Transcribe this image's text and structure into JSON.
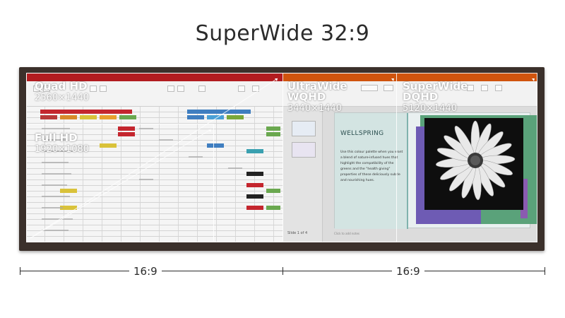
{
  "title": "SuperWide 32:9",
  "overlays": [
    {
      "id": "quad-hd",
      "name": "Quad HD",
      "resolution": "2560×1440"
    },
    {
      "id": "full-hd",
      "name": "Full HD",
      "resolution": "1920×1080"
    },
    {
      "id": "ultrawide",
      "name": "UltraWide",
      "subname": "WQHD",
      "resolution": "3440×1440"
    },
    {
      "id": "superwide",
      "name": "SuperWide",
      "subname": "DQHD",
      "resolution": "5120×1440"
    }
  ],
  "slide": {
    "heading": "WELLSPRING",
    "body": "Use this colour palette when you want a blend of nature-infused hues that highlight the compatibility of the greens and the \"health giving\" properties of these deliciously subtle and nourishing hues.",
    "slide_count": "Slide 1 of 4",
    "notes_placeholder": "Click to add notes"
  },
  "ruler": {
    "left_label": "16:9",
    "right_label": "16:9"
  },
  "colors": {
    "excel_ribbon": "#b21c20",
    "ppt_ribbon": "#d0540e",
    "bezel": "#3b302b",
    "slide_green": "#5aa27a",
    "slide_purple": "#6e5bb4"
  }
}
